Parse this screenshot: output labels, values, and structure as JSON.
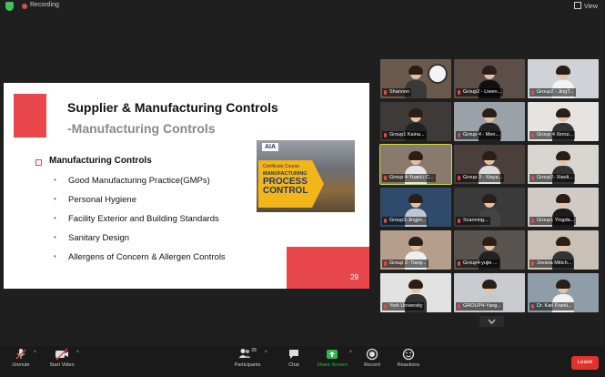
{
  "topbar": {
    "recording_label": "Recording",
    "view_label": "View"
  },
  "slide": {
    "title": "Supplier & Manufacturing Controls",
    "subtitle": "-Manufacturing Controls",
    "section": "Manufacturing  Controls",
    "items": [
      "Good Manufacturing Practice(GMPs)",
      "Personal Hygiene",
      "Facility Exterior and Building Standards",
      "Sanitary Design",
      "Allergens of Concern & Allergen Controls"
    ],
    "page_number": "29",
    "certificate": {
      "logo": "AIA",
      "course_label": "Certificate Course",
      "line1": "MANUFACTURING",
      "line2": "PROCESS CONTROL"
    }
  },
  "participants": [
    {
      "name": "Shannon"
    },
    {
      "name": "Group2 - Liwen..."
    },
    {
      "name": "Group2 - JingT..."
    },
    {
      "name": "Group1 Kaina..."
    },
    {
      "name": "Group 4 - Men..."
    },
    {
      "name": "Group 4 Xinrui..."
    },
    {
      "name": "Group 4-YuanLi C..."
    },
    {
      "name": "Group 3 - Xiaya..."
    },
    {
      "name": "Group2- Xiaoli..."
    },
    {
      "name": "Group3-Jingjin..."
    },
    {
      "name": "Scanning..."
    },
    {
      "name": "Group1 Yingda..."
    },
    {
      "name": "Group 2- Tiany..."
    },
    {
      "name": "Group4-yujie ..."
    },
    {
      "name": "Jovana Mitich..."
    },
    {
      "name": "York University"
    },
    {
      "name": "GROUP4-Yang..."
    },
    {
      "name": "Dr. Karl Franti..."
    }
  ],
  "toolbar": {
    "unmute": "Unmute",
    "start_video": "Start Video",
    "participants": "Participants",
    "participants_count": "28",
    "chat": "Chat",
    "share_screen": "Share Screen",
    "record": "Record",
    "reactions": "Reactions",
    "leave": "Leave"
  },
  "colors": {
    "accent_red": "#e8474b",
    "leave_red": "#e0332c",
    "share_green": "#2fb84a",
    "active_speaker": "#c6e03a"
  }
}
